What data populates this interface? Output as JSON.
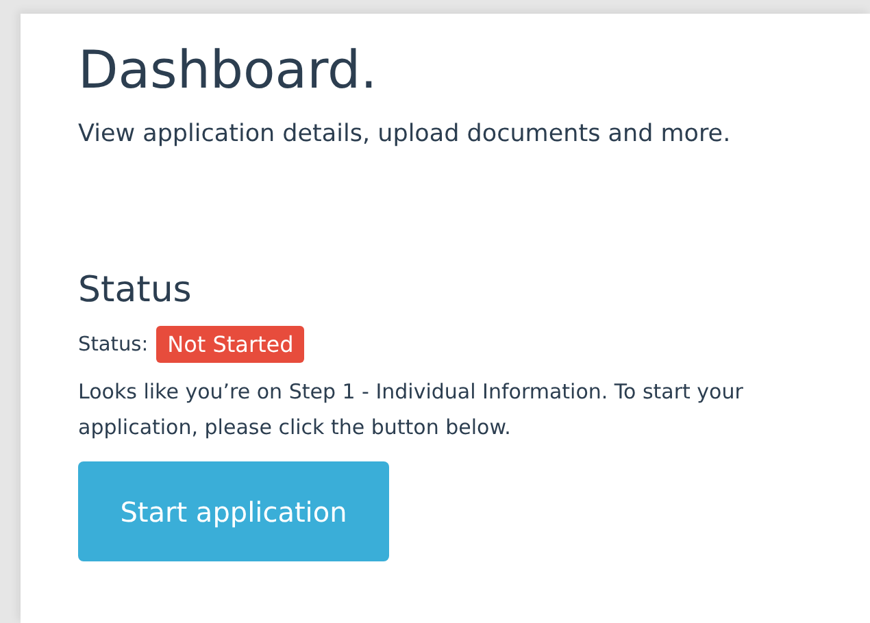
{
  "header": {
    "title": "Dashboard.",
    "subtitle": "View application details, upload documents and more."
  },
  "status_section": {
    "heading": "Status",
    "label": "Status:",
    "badge": {
      "text": "Not Started",
      "color": "#e74c3c"
    },
    "message": "Looks like you’re on Step 1 - Individual Information. To start your application, please click the button below.",
    "button": "Start application"
  }
}
